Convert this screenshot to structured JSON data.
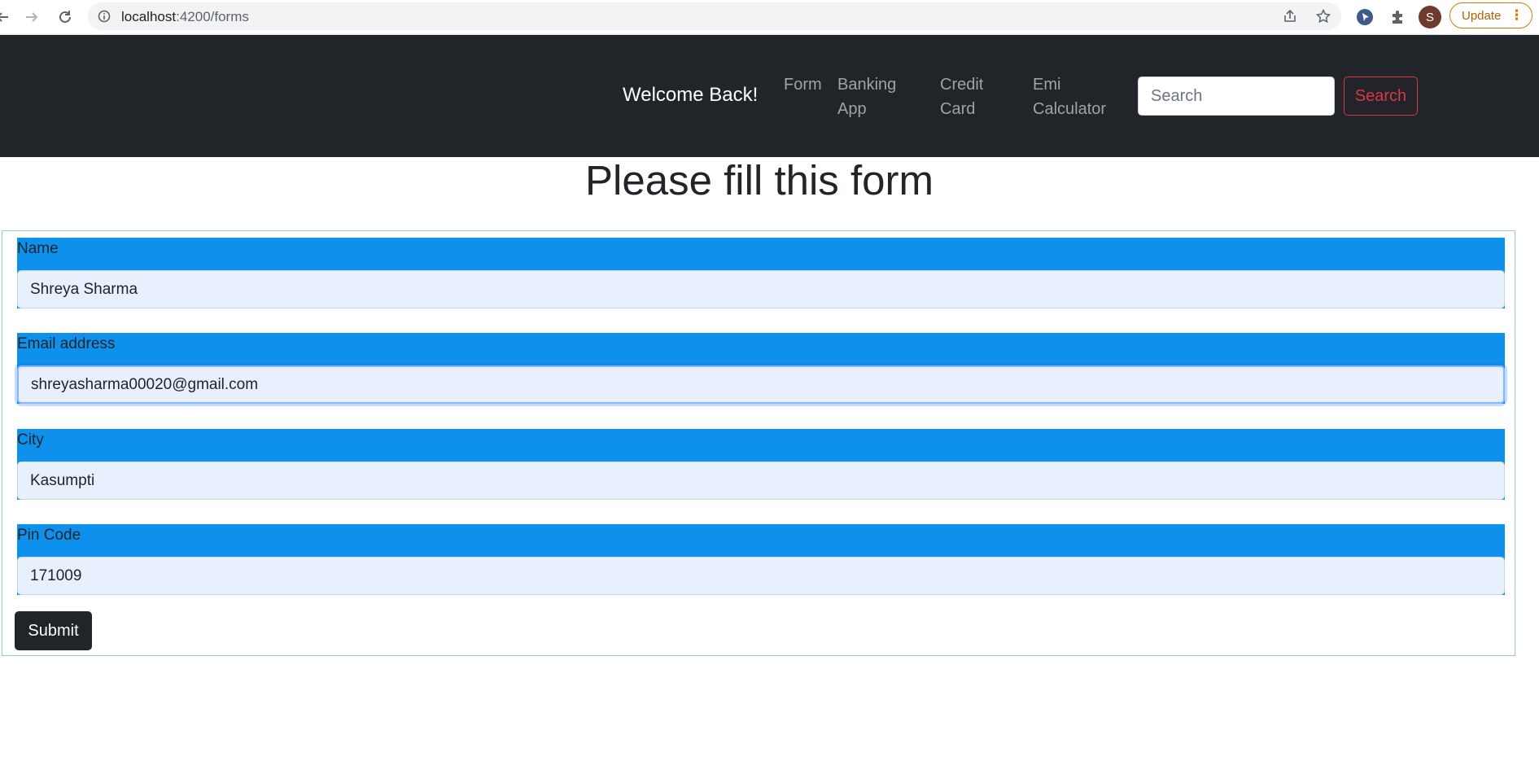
{
  "browser": {
    "url_host": "localhost",
    "url_path": ":4200/forms",
    "profile_initial": "S",
    "update_label": "Update"
  },
  "navbar": {
    "brand": "Welcome Back!",
    "links": [
      {
        "label_line1": "Form",
        "label_line2": ""
      },
      {
        "label_line1": "Banking",
        "label_line2": "App"
      },
      {
        "label_line1": "Credit",
        "label_line2": "Card"
      },
      {
        "label_line1": "Emi",
        "label_line2": "Calculator"
      }
    ],
    "search_placeholder": "Search",
    "search_button": "Search"
  },
  "form": {
    "title": "Please fill this form",
    "fields": [
      {
        "label": "Name",
        "value": "Shreya Sharma"
      },
      {
        "label": "Email address",
        "value": "shreyasharma00020@gmail.com"
      },
      {
        "label": "City",
        "value": "Kasumpti"
      },
      {
        "label": "Pin Code",
        "value": "171009"
      }
    ],
    "submit_label": "Submit"
  },
  "colors": {
    "navbar_bg": "#212529",
    "field_label_bg": "#0d91ed",
    "input_autofill_bg": "#e8f0fe",
    "search_button": "#dc3545",
    "update_button": "#e37400"
  },
  "icons": [
    "back-icon",
    "forward-icon",
    "reload-icon",
    "site-info-icon",
    "share-icon",
    "bookmark-star-icon",
    "extension-icon",
    "puzzle-icon",
    "more-icon"
  ]
}
